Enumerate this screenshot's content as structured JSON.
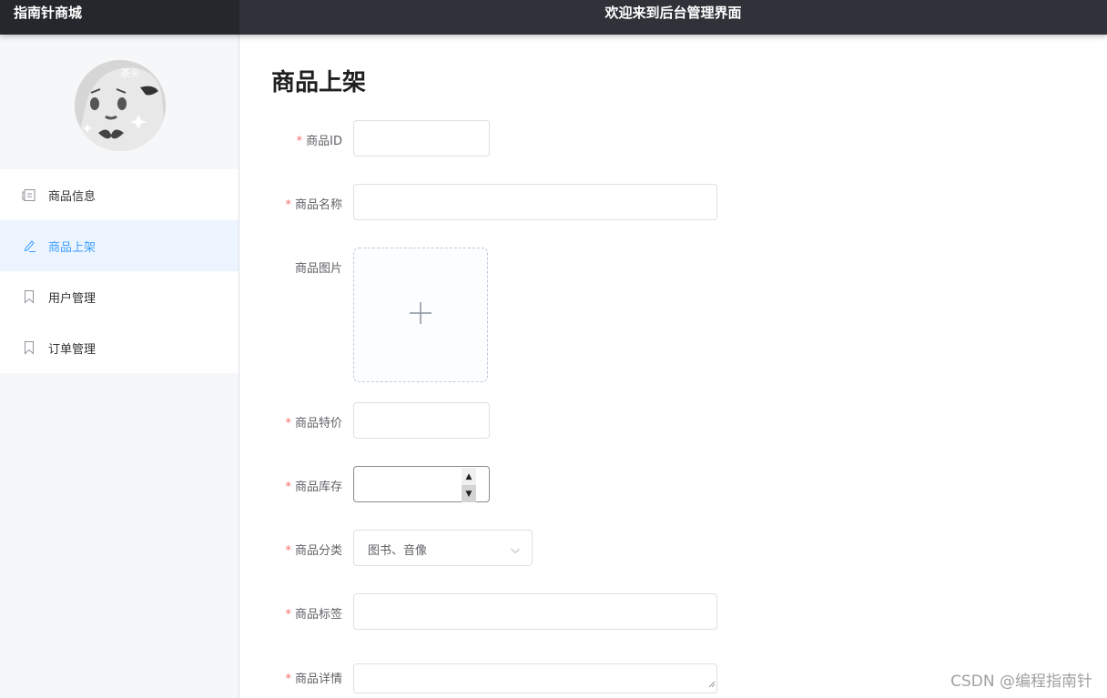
{
  "header": {
    "brand": "指南针商城",
    "welcome": "欢迎来到后台管理界面"
  },
  "sidebar": {
    "avatar_icon": "avatar-icon",
    "items": [
      {
        "label": "商品信息",
        "icon": "document-icon"
      },
      {
        "label": "商品上架",
        "icon": "edit-icon",
        "active": true
      },
      {
        "label": "用户管理",
        "icon": "bookmark-icon"
      },
      {
        "label": "订单管理",
        "icon": "bookmark-icon"
      }
    ]
  },
  "main": {
    "title": "商品上架",
    "fields": {
      "id": {
        "label": "商品ID",
        "required": true,
        "value": ""
      },
      "name": {
        "label": "商品名称",
        "required": true,
        "value": ""
      },
      "image": {
        "label": "商品图片",
        "required": false,
        "icon": "plus-icon"
      },
      "price": {
        "label": "商品特价",
        "required": true,
        "value": ""
      },
      "stock": {
        "label": "商品库存",
        "required": true,
        "value": ""
      },
      "category": {
        "label": "商品分类",
        "required": true,
        "value": "图书、音像"
      },
      "tags": {
        "label": "商品标签",
        "required": true,
        "value": ""
      },
      "detail": {
        "label": "商品详情",
        "required": true,
        "value": ""
      }
    }
  },
  "watermark": "CSDN @编程指南针",
  "colors": {
    "topbar": "#2f3339",
    "brand_bg": "#24272c",
    "accent": "#409eff",
    "active_bg": "#ecf5ff",
    "required": "#f56c6c"
  }
}
